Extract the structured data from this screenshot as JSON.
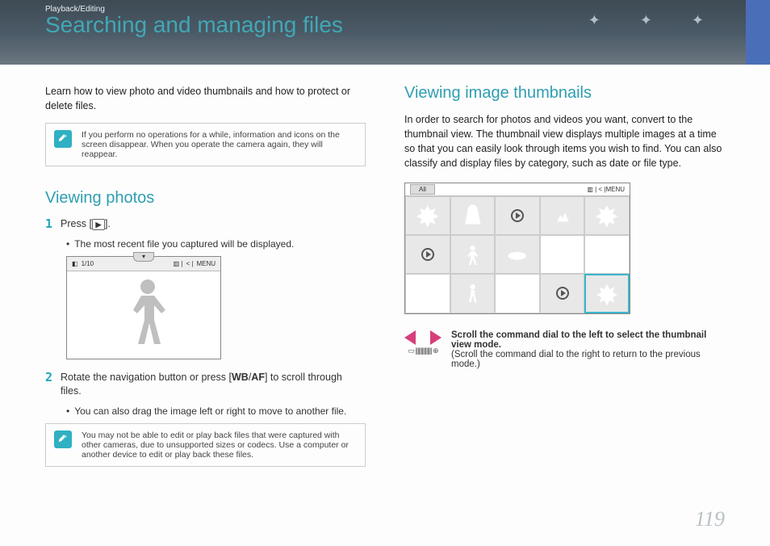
{
  "header": {
    "breadcrumb": "Playback/Editing",
    "title": "Searching and managing files"
  },
  "left": {
    "intro": "Learn how to view photo and video thumbnails and how to protect or delete files.",
    "note1": "If you perform no operations for a while, information and icons on the screen disappear. When you operate the camera again, they will reappear.",
    "section_title": "Viewing photos",
    "step1_prefix": "Press [",
    "step1_suffix": "].",
    "step1_bullet": "The most recent file you captured will be displayed.",
    "preview_counter": "1/10",
    "preview_menu": "MENU",
    "step2_a": "Rotate the navigation button or press [",
    "step2_wb": "WB",
    "step2_sep": "/",
    "step2_af": "AF",
    "step2_b": "] to scroll through files.",
    "step2_bullet": "You can also drag the image left or right to move to another file.",
    "note2": "You may not be able to edit or play back files that were captured with other cameras, due to unsupported sizes or codecs. Use a computer or another device to edit or play back these files."
  },
  "right": {
    "section_title": "Viewing image thumbnails",
    "intro": "In order to search for photos and videos you want, convert to the thumbnail view. The thumbnail view displays multiple images at a time so that you can easily look through items you wish to find. You can also classify and display files by category, such as date or file type.",
    "thumb_all": "All",
    "thumb_menu": "MENU",
    "dial_bar": "▭ ||||||||||||||| ⊕",
    "dial_bold": "Scroll the command dial to the left to select the thumbnail view mode.",
    "dial_plain": "(Scroll the command dial to the right to return to the previous mode.)"
  },
  "page_number": "119"
}
